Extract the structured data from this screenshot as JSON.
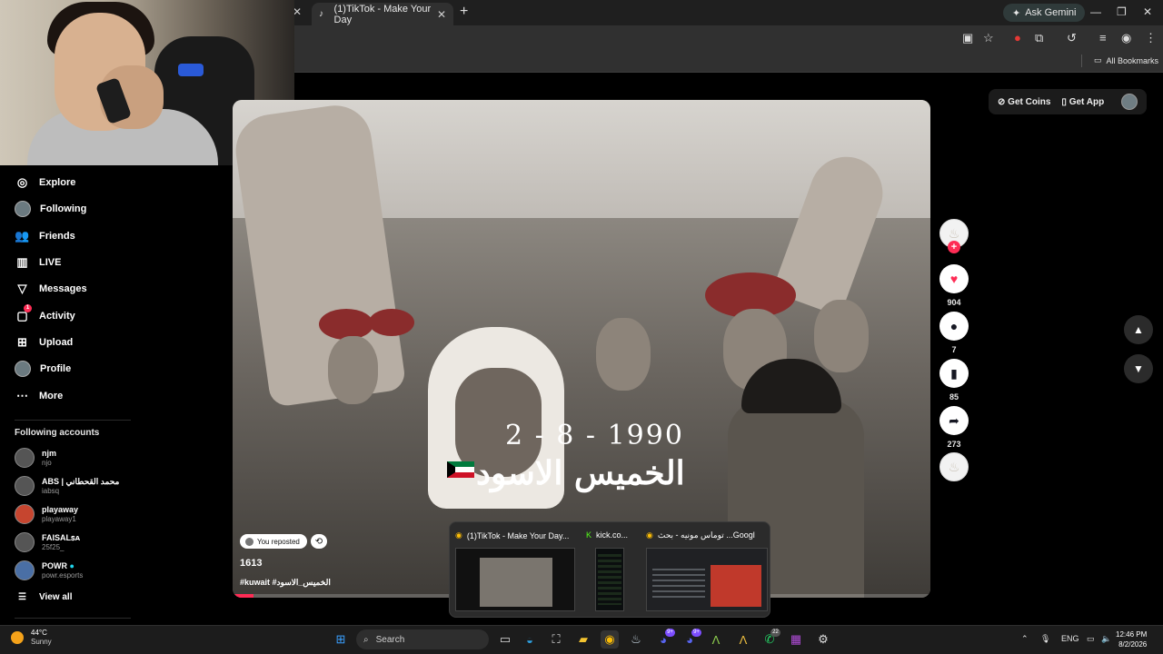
{
  "browser": {
    "tab_title": "(1)TikTok - Make Your Day",
    "new_tab_icon": "plus-icon",
    "gemini_label": "Ask Gemini",
    "bookmarks_label": "All Bookmarks"
  },
  "sidebar": {
    "nav": [
      {
        "label": "Explore",
        "icon": "compass-icon"
      },
      {
        "label": "Following",
        "icon": "avatar"
      },
      {
        "label": "Friends",
        "icon": "friends-icon"
      },
      {
        "label": "LIVE",
        "icon": "live-icon"
      },
      {
        "label": "Messages",
        "icon": "send-icon"
      },
      {
        "label": "Activity",
        "icon": "activity-icon",
        "badge": "1"
      },
      {
        "label": "Upload",
        "icon": "plus-square-icon"
      },
      {
        "label": "Profile",
        "icon": "avatar"
      },
      {
        "label": "More",
        "icon": "ellipsis-icon"
      }
    ],
    "following_title": "Following accounts",
    "accounts": [
      {
        "name": "njm",
        "handle": "njo"
      },
      {
        "name": "ABS | محمد القحطاني",
        "handle": "iabsq"
      },
      {
        "name": "playaway",
        "handle": "playaway1"
      },
      {
        "name": "FAISALꜱᴀ",
        "handle": "25f25_"
      },
      {
        "name": "POWR",
        "handle": "powr.esports"
      }
    ],
    "view_all": "View all"
  },
  "topbar": {
    "get_coins": "Get Coins",
    "get_app": "Get App"
  },
  "video": {
    "overlay_date": "2 - 8 - 1990",
    "overlay_arabic": "الخميس الاسود",
    "reposted_label": "You reposted",
    "author": "1613",
    "caption": "#kuwait #الخميس_الاسود",
    "progress": 0.03
  },
  "actions": {
    "likes": "904",
    "comments": "7",
    "saves": "85",
    "shares": "273"
  },
  "taskbar_preview": [
    {
      "label": "(1)TikTok - Make Your Day..."
    },
    {
      "label": "kick.co..."
    },
    {
      "label": "توماس مونيه - بحث ...Googl"
    }
  ],
  "taskbar": {
    "weather_temp": "44°C",
    "weather_desc": "Sunny",
    "search_placeholder": "Search",
    "lang": "ENG",
    "time": "12:46 PM",
    "date": "8/2/2026",
    "badge_discord1": "9+",
    "badge_discord2": "9+",
    "badge_whatsapp": "22"
  },
  "colors": {
    "accent": "#fe2c55",
    "background": "#000000"
  }
}
